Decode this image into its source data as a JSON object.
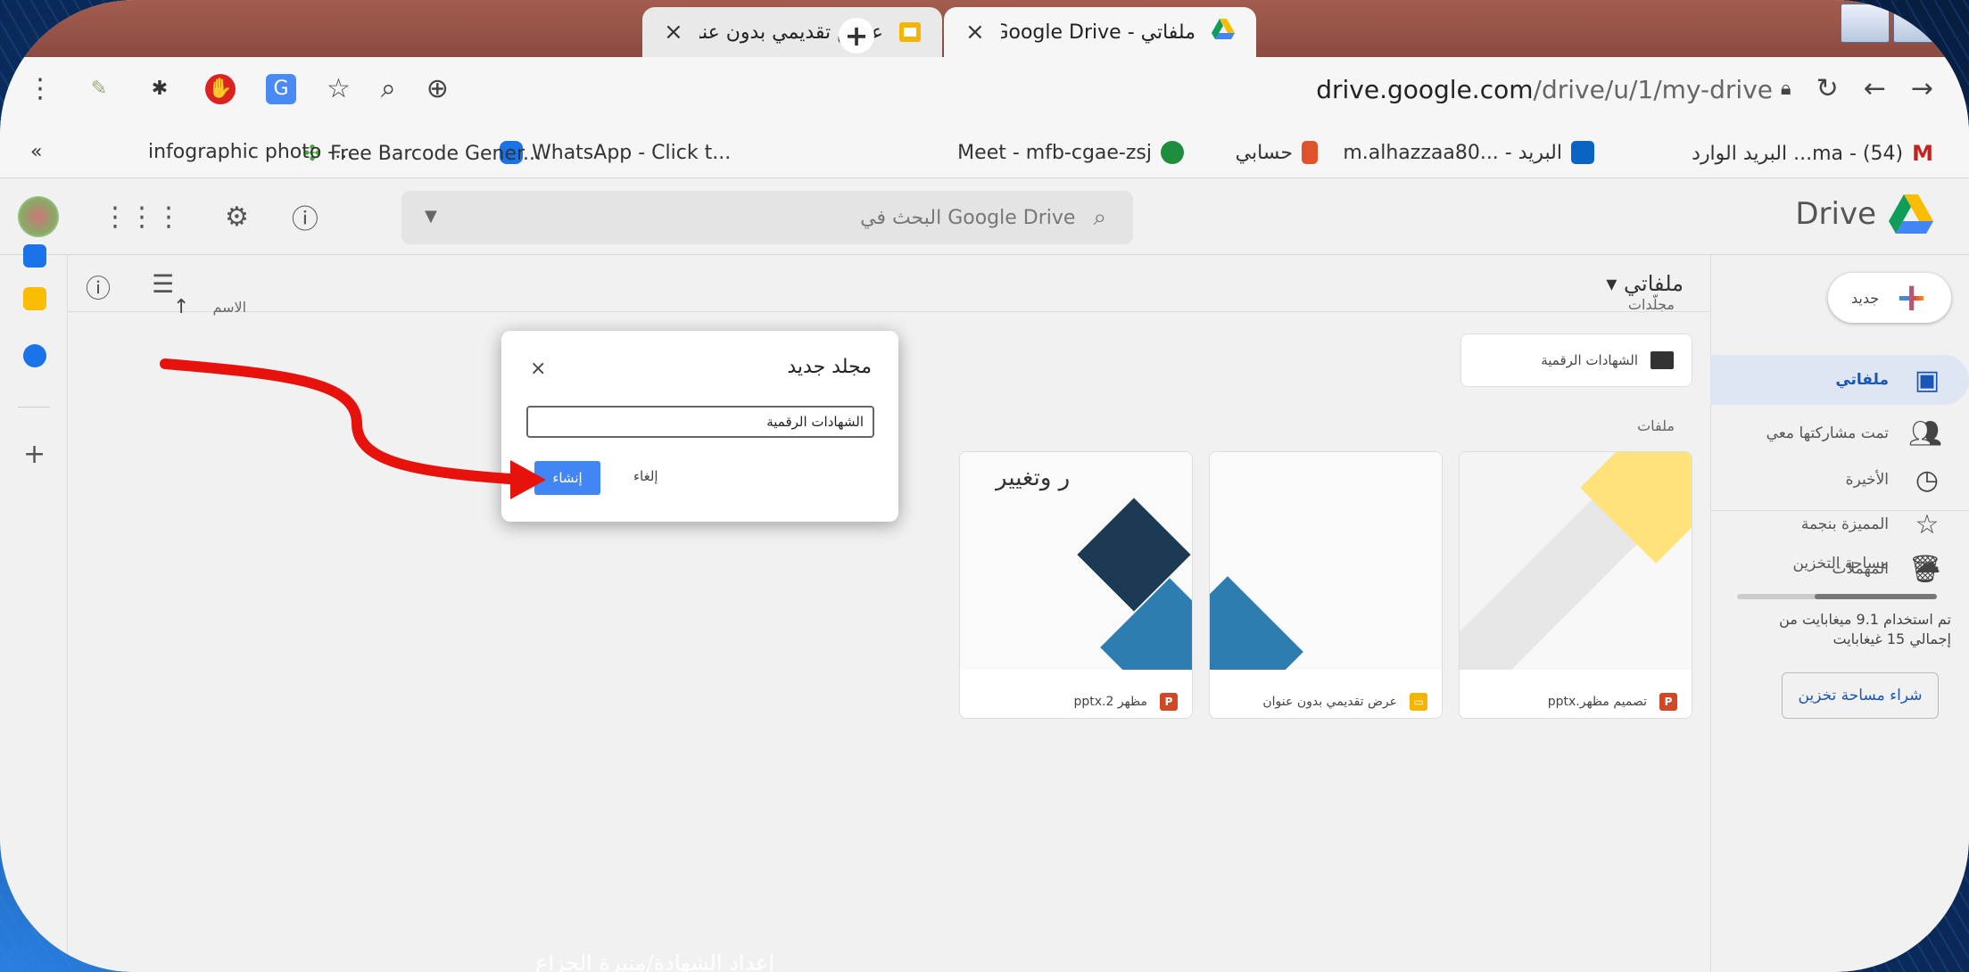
{
  "tabs": [
    {
      "title": "ملفاتي - Google Drive",
      "close": "×"
    },
    {
      "title": "عرض تقديمي بدون عنوان - العروض التقديـ",
      "close": "×"
    }
  ],
  "new_tab": "+",
  "address": {
    "domain": "drive.google.com",
    "path": "/drive/u/1/my-drive"
  },
  "bookmarks": [
    {
      "label": "البريد الوارد ...ma - (54)",
      "color": "#c5221f"
    },
    {
      "label": "m.alhazzaa80... - البريد",
      "color": "#0a64c4"
    },
    {
      "label": "حسابي",
      "color": "#e0522a"
    },
    {
      "label": "Meet - mfb-cgae-zsj",
      "color": "#1e8e3e"
    },
    {
      "label": "WhatsApp - Click t...",
      "color": "#1a73e8"
    },
    {
      "label": "Free Barcode Gener...",
      "color": "#4aa83a"
    },
    {
      "label": "infographic photo -...",
      "color": ""
    },
    {
      "label": "«",
      "color": ""
    }
  ],
  "drive": {
    "logo_text": "Drive",
    "search_placeholder": "البحث في Google Drive",
    "new_button": "جديد",
    "nav": [
      {
        "label": "ملفاتي",
        "icon": "drive-icon",
        "active": true
      },
      {
        "label": "تمت مشاركتها معي",
        "icon": "people-icon",
        "active": false
      },
      {
        "label": "الأخيرة",
        "icon": "clock-icon",
        "active": false
      },
      {
        "label": "المميزة بنجمة",
        "icon": "star-icon",
        "active": false
      },
      {
        "label": "المهملات",
        "icon": "trash-icon",
        "active": false
      },
      {
        "label": "مساحة التخزين",
        "icon": "cloud-icon",
        "active": false
      }
    ],
    "storage_fraction": 0.61,
    "storage_text": "تم استخدام 9.1 ميغابايت من إجمالي 15 غيغابايت",
    "buy_storage": "شراء مساحة تخزين",
    "my_drive_title": "ملفاتي ▾",
    "folders_label": "مجلّدات",
    "files_label": "ملفات",
    "name_sort": "الاسم",
    "folder_name": "الشهادات الرقمية",
    "files": [
      {
        "name": "تصميم مظهر.pptx",
        "type": "P",
        "color": "#d24726"
      },
      {
        "name": "عرض تقديمي بدون عنوان",
        "type": "▭",
        "color": "#f4b400"
      },
      {
        "name": "مظهر 2.pptx",
        "type": "P",
        "color": "#d24726"
      }
    ],
    "card_overlay_text": "ر وتغيير"
  },
  "dialog": {
    "title": "مجلد جديد",
    "close": "×",
    "input_value": "الشهادات الرقمية",
    "create": "إنشاء",
    "cancel": "إلغاء"
  },
  "caption": "إعداد الشهادة/منيرة الحزاع"
}
